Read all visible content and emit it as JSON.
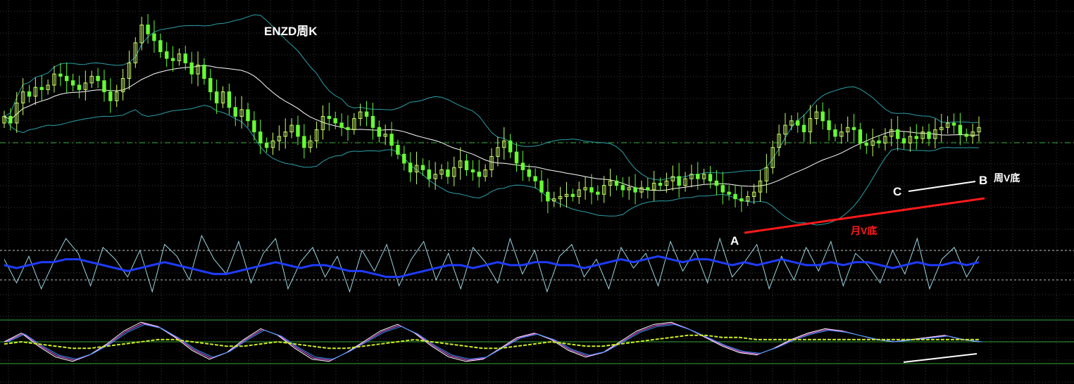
{
  "title": "ENZD周K",
  "annotations": {
    "point_a": "A",
    "point_b": "B",
    "point_c": "C",
    "weekly_v_bottom": "周V底",
    "monthly_v_bottom": "月V底"
  },
  "colors": {
    "background": "#000000",
    "grid": "#3a3a3a",
    "candle_up": "#ccff66",
    "candle_down": "#66ff33",
    "bollinger": "#2aa0a8",
    "moving_average": "#ffffff",
    "horizontal_level": "#33aa33",
    "oscillator_fast": "#9ad4e0",
    "oscillator_slow": "#1f3cff",
    "stoch_lines": [
      "#ffffff",
      "#ff66ff",
      "#3399ff"
    ],
    "stoch_signal": "#ccee22",
    "trendline_monthly": "#ff1a1a",
    "trendline_weekly": "#ffffff"
  },
  "chart_data": [
    {
      "type": "candlestick",
      "panel": "price",
      "indicators": [
        "bollinger-bands",
        "moving-average"
      ],
      "grid": true,
      "close": [
        0.5,
        0.2,
        1.1,
        1.6,
        1.4,
        1.8,
        1.7,
        1.9,
        2.4,
        2.3,
        2.1,
        1.9,
        1.7,
        2.0,
        2.3,
        2.1,
        1.6,
        1.2,
        1.6,
        2.2,
        2.9,
        3.8,
        4.6,
        4.2,
        3.9,
        3.4,
        3.1,
        3.0,
        3.3,
        2.9,
        2.4,
        2.8,
        2.2,
        1.6,
        1.1,
        1.6,
        0.9,
        0.5,
        0.8,
        0.3,
        -0.2,
        -0.7,
        -0.9,
        -0.6,
        -0.4,
        -0.2,
        0.1,
        -0.4,
        -0.9,
        -0.6,
        -0.1,
        0.5,
        0.4,
        0.2,
        0.0,
        -0.1,
        0.4,
        0.7,
        0.5,
        0.0,
        -0.4,
        -0.3,
        -0.8,
        -1.2,
        -1.6,
        -2.0,
        -1.7,
        -1.9,
        -2.3,
        -2.1,
        -1.9,
        -2.2,
        -1.8,
        -1.5,
        -1.9,
        -2.0,
        -2.2,
        -1.9,
        -1.3,
        -0.9,
        -0.6,
        -1.1,
        -1.6,
        -1.9,
        -2.2,
        -2.4,
        -2.9,
        -3.3,
        -3.2,
        -3.1,
        -3.0,
        -3.1,
        -2.8,
        -2.7,
        -2.9,
        -3.0,
        -2.6,
        -2.4,
        -2.6,
        -2.8,
        -2.7,
        -2.9,
        -2.7,
        -2.8,
        -2.5,
        -2.6,
        -2.4,
        -2.2,
        -2.6,
        -2.3,
        -2.1,
        -2.3,
        -2.1,
        -2.4,
        -2.6,
        -2.9,
        -3.0,
        -3.2,
        -3.3,
        -3.1,
        -2.9,
        -2.4,
        -1.8,
        -0.9,
        -0.3,
        0.1,
        0.3,
        0.1,
        -0.2,
        0.4,
        0.7,
        0.3,
        -0.1,
        -0.4,
        -0.2,
        0.0,
        -0.1,
        -0.7,
        -0.8,
        -0.6,
        -0.7,
        -0.4,
        -0.1,
        -0.5,
        -0.7,
        -0.4,
        -0.5,
        -0.2,
        -0.5,
        -0.1,
        0.0,
        0.2,
        0.1,
        -0.3,
        -0.4,
        -0.2,
        0.0
      ]
    },
    {
      "type": "line",
      "panel": "oscillator",
      "series": [
        {
          "values": [
            0.2,
            -0.6,
            0.3,
            -0.8,
            0.1,
            0.9,
            0.4,
            -0.7,
            0.6,
            0.2,
            -0.4,
            0.5,
            -0.9,
            0.7,
            0.3,
            -0.5,
            1.0,
            0.2,
            -0.3,
            0.8,
            -0.6,
            0.4,
            0.9,
            -0.8,
            0.1,
            0.6,
            -0.4,
            0.3,
            -0.9,
            0.5,
            -0.2,
            0.7,
            -0.7,
            0.2,
            0.8,
            -0.5,
            0.4,
            -0.8,
            0.6,
            0.1,
            -0.6,
            0.9,
            -0.3,
            0.5,
            -0.9,
            0.3,
            0.7,
            -0.4,
            0.2,
            -0.8,
            0.6,
            -0.1,
            0.4,
            -0.7,
            0.8,
            -0.2,
            0.5,
            -0.6,
            0.9,
            -0.4,
            0.1,
            0.7,
            -0.8,
            0.3,
            -0.5,
            0.6,
            -0.2,
            0.8,
            -0.7,
            0.4,
            0.0,
            -0.6,
            0.5,
            -0.3,
            0.9,
            -0.8,
            0.2,
            0.6,
            -0.4,
            0.3
          ]
        },
        {
          "values": [
            0.0,
            -0.1,
            0.0,
            0.1,
            0.1,
            0.2,
            0.2,
            0.1,
            0.0,
            -0.1,
            -0.2,
            -0.1,
            0.0,
            0.1,
            0.0,
            -0.1,
            -0.2,
            -0.3,
            -0.3,
            -0.2,
            -0.1,
            0.0,
            0.1,
            0.0,
            -0.1,
            0.0,
            0.0,
            -0.1,
            -0.2,
            -0.2,
            -0.3,
            -0.4,
            -0.4,
            -0.3,
            -0.2,
            -0.1,
            0.0,
            0.0,
            -0.1,
            0.0,
            0.1,
            0.0,
            0.0,
            0.1,
            0.1,
            0.0,
            0.0,
            -0.1,
            0.0,
            0.1,
            0.2,
            0.1,
            0.2,
            0.3,
            0.2,
            0.1,
            0.2,
            0.2,
            0.1,
            0.0,
            0.1,
            0.0,
            0.1,
            0.2,
            0.1,
            0.0,
            0.0,
            0.1,
            0.0,
            0.1,
            0.1,
            0.0,
            -0.1,
            0.0,
            0.1,
            0.0,
            0.0,
            0.1,
            0.0,
            0.1
          ]
        }
      ],
      "levels": [
        0.5,
        -0.5
      ]
    },
    {
      "type": "line",
      "panel": "stochastic",
      "series": [
        {
          "values": [
            0.0,
            0.4,
            -0.2,
            -0.7,
            -0.9,
            -0.6,
            -0.1,
            0.5,
            0.9,
            0.7,
            0.2,
            -0.4,
            -0.8,
            -0.5,
            0.1,
            0.6,
            0.3,
            -0.3,
            -0.8,
            -0.9,
            -0.5,
            0.0,
            0.5,
            0.8,
            0.4,
            -0.2,
            -0.7,
            -0.9,
            -0.8,
            -0.3,
            0.2,
            0.4,
            0.1,
            -0.4,
            -0.7,
            -0.5,
            0.0,
            0.5,
            0.8,
            0.9,
            0.6,
            0.2,
            -0.2,
            -0.5,
            -0.6,
            -0.3,
            0.1,
            0.4,
            0.6,
            0.5,
            0.3,
            0.1,
            0.0,
            0.1,
            0.2,
            0.3,
            0.1,
            0.0
          ]
        },
        {
          "values": [
            -0.1,
            0.0,
            -0.1,
            -0.2,
            -0.3,
            -0.3,
            -0.2,
            -0.1,
            0.0,
            0.1,
            0.1,
            0.0,
            -0.1,
            -0.2,
            -0.2,
            -0.1,
            0.0,
            -0.1,
            -0.2,
            -0.3,
            -0.3,
            -0.2,
            -0.1,
            0.0,
            0.1,
            0.0,
            -0.1,
            -0.2,
            -0.3,
            -0.3,
            -0.2,
            -0.1,
            0.0,
            -0.1,
            -0.2,
            -0.2,
            -0.1,
            0.0,
            0.1,
            0.2,
            0.3,
            0.3,
            0.2,
            0.2,
            0.1,
            0.1,
            0.1,
            0.1,
            0.1,
            0.1,
            0.1,
            0.1,
            0.1,
            0.1,
            0.1,
            0.1,
            0.1,
            0.1
          ]
        }
      ],
      "levels": [
        1,
        0,
        -1
      ]
    }
  ]
}
